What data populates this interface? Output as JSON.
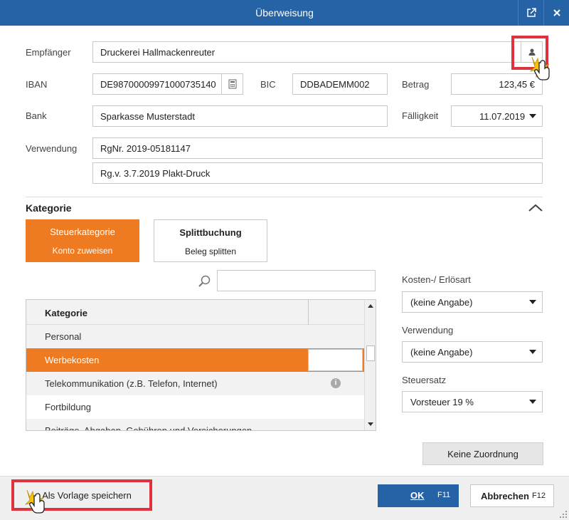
{
  "window": {
    "title": "Überweisung"
  },
  "form": {
    "recipient_label": "Empfänger",
    "recipient_value": "Druckerei Hallmackenreuter",
    "iban_label": "IBAN",
    "iban_value": "DE98700009971000735140",
    "bic_label": "BIC",
    "bic_value": "DDBADEMM002",
    "amount_label": "Betrag",
    "amount_value": "123,45 €",
    "bank_label": "Bank",
    "bank_value": "Sparkasse Musterstadt",
    "due_label": "Fälligkeit",
    "due_value": "11.07.2019",
    "purpose_label": "Verwendung",
    "purpose_line1": "RgNr. 2019-05181147",
    "purpose_line2": "Rg.v. 3.7.2019 Plakt-Druck"
  },
  "category_section": {
    "title": "Kategorie",
    "tabs": [
      {
        "title": "Steuerkategorie",
        "subtitle": "Konto zuweisen",
        "active": true
      },
      {
        "title": "Splittbuchung",
        "subtitle": "Beleg splitten",
        "active": false
      }
    ],
    "search_value": "",
    "table": {
      "header": "Kategorie",
      "rows": [
        {
          "label": "Personal"
        },
        {
          "label": "Werbekosten"
        },
        {
          "label": "Telekommunikation (z.B. Telefon, Internet)"
        },
        {
          "label": "Fortbildung"
        },
        {
          "label": "Beiträge, Abgaben, Gebühren und Versicherungen"
        }
      ],
      "selected_index": 1,
      "info_row_index": 2,
      "scroll_position": 0.45
    }
  },
  "side_panel": {
    "cost_type_label": "Kosten-/ Erlösart",
    "cost_type_value": "(keine Angabe)",
    "usage_label": "Verwendung",
    "usage_value": "(keine Angabe)",
    "tax_label": "Steuersatz",
    "tax_value": "Vorsteuer 19 %",
    "no_assignment_label": "Keine Zuordnung"
  },
  "footer": {
    "save_template_label": "Als Vorlage speichern",
    "ok_label": "OK",
    "ok_key": "F11",
    "cancel_label": "Abbrechen",
    "cancel_key": "F12"
  },
  "colors": {
    "titlebar": "#2563a6",
    "accent_orange": "#ee7b22",
    "highlight_red": "#e0323c"
  },
  "icons": {
    "contact_picker": "person-icon",
    "calculator": "calculator-icon",
    "search": "search-icon",
    "popout": "popout-icon",
    "close": "close-icon",
    "collapse": "chevron-up-icon",
    "info": "info-icon"
  }
}
